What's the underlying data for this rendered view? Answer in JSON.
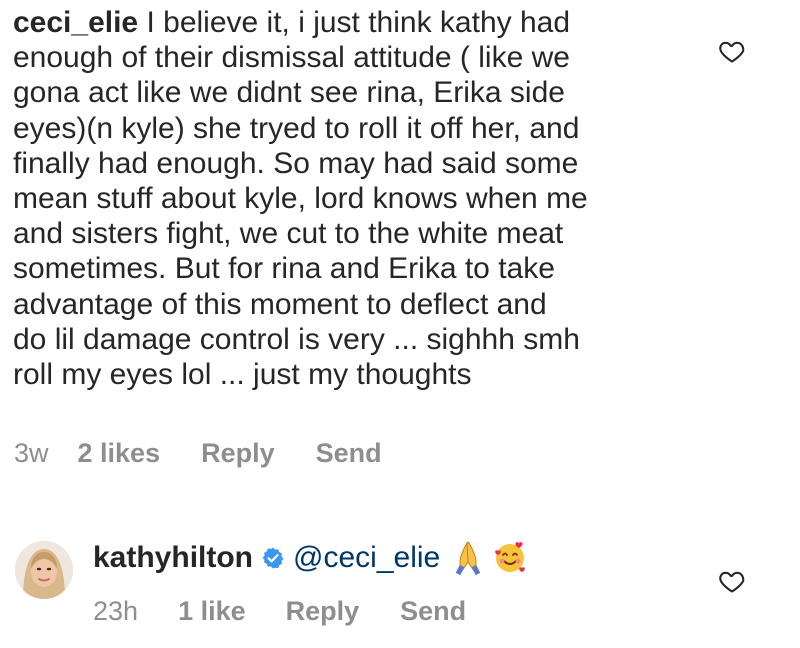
{
  "comments": [
    {
      "username": "ceci_elie",
      "text": " I believe it, i just think kathy had\nenough of their dismissal attitude ( like we\ngona act like we didnt see rina, Erika side\neyes)(n kyle) she tryed to roll it off her, and\nfinally had enough. So may had said some\nmean stuff about kyle, lord knows when me\nand sisters fight, we cut to the white meat\nsometimes. But for rina and Erika to take\nadvantage of this moment to deflect and\ndo lil damage control is very ... sighhh smh\nroll my eyes lol ... just my thoughts",
      "time": "3w",
      "likes": "2 likes",
      "reply_label": "Reply",
      "send_label": "Send"
    },
    {
      "username": "kathyhilton",
      "mention": "@ceci_elie",
      "emojis": [
        "folded-hands-emoji",
        "smiling-face-with-hearts-emoji"
      ],
      "time": "23h",
      "likes": "1 like",
      "reply_label": "Reply",
      "send_label": "Send",
      "verified": true
    }
  ],
  "colors": {
    "text": "#262626",
    "muted": "#8e8e8e",
    "mention": "#00376b",
    "verified": "#3897f0"
  },
  "icons": {
    "like": "heart-outline-icon",
    "verified": "verified-badge-icon"
  }
}
